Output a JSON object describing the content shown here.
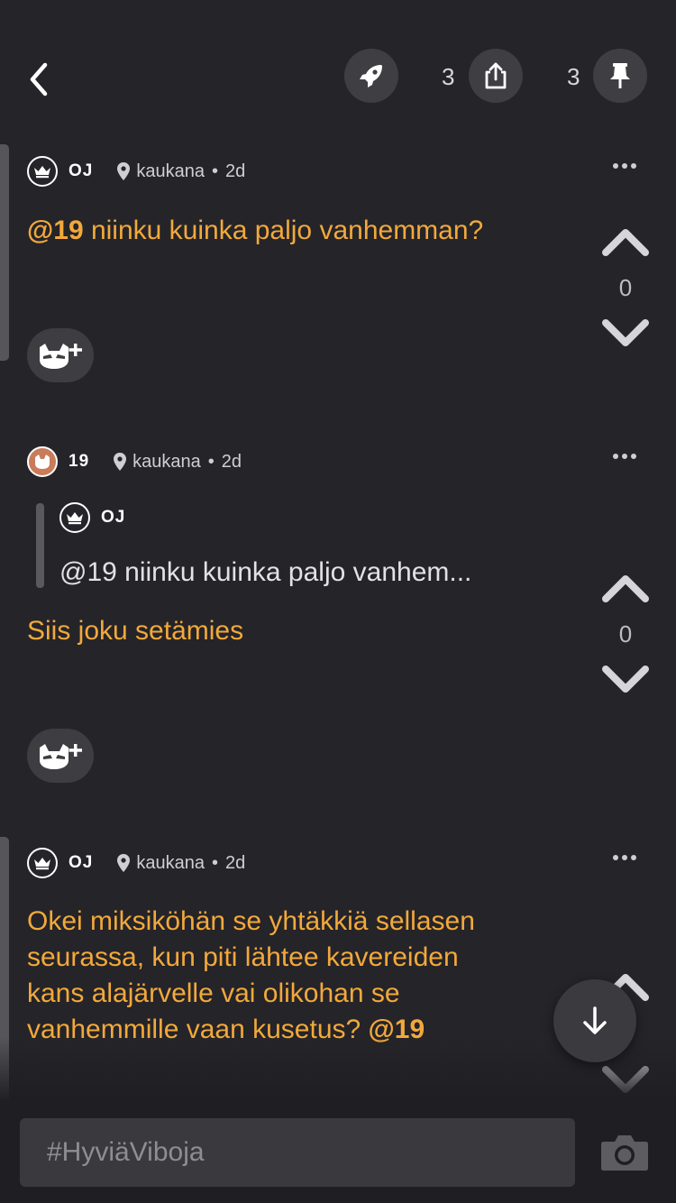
{
  "header": {
    "share_count": "3",
    "pin_count": "3"
  },
  "posts": [
    {
      "author": "OJ",
      "location": "kaukana",
      "separator": "•",
      "age": "2d",
      "mention": "@19",
      "text": " niinku kuinka paljo vanhemman?",
      "votes": "0"
    },
    {
      "author": "19",
      "location": "kaukana",
      "separator": "•",
      "age": "2d",
      "quote_author": "OJ",
      "quote_text": "@19 niinku kuinka paljo vanhem...",
      "text": "Siis joku setämies",
      "votes": "0"
    },
    {
      "author": "OJ",
      "location": "kaukana",
      "separator": "•",
      "age": "2d",
      "text_lines": [
        "Okei miksiköhän se yhtäkkiä sellasen",
        "seurassa, kun piti lähtee kavereiden",
        "kans alajärvelle vai olikohan se",
        "vanhemmille vaan kusetus? "
      ],
      "mention_end": "@19"
    }
  ],
  "composer": {
    "placeholder": "#HyviäViboja"
  },
  "colors": {
    "background": "#252429",
    "accent": "#f2a93b",
    "button": "#3f3e43"
  },
  "icons": [
    "back-chevron-icon",
    "rocket-icon",
    "share-icon",
    "pin-icon",
    "crown-icon",
    "location-pin-icon",
    "more-dots-icon",
    "upvote-icon",
    "downvote-icon",
    "follow-cat-icon",
    "scroll-down-arrow-icon",
    "camera-icon"
  ]
}
